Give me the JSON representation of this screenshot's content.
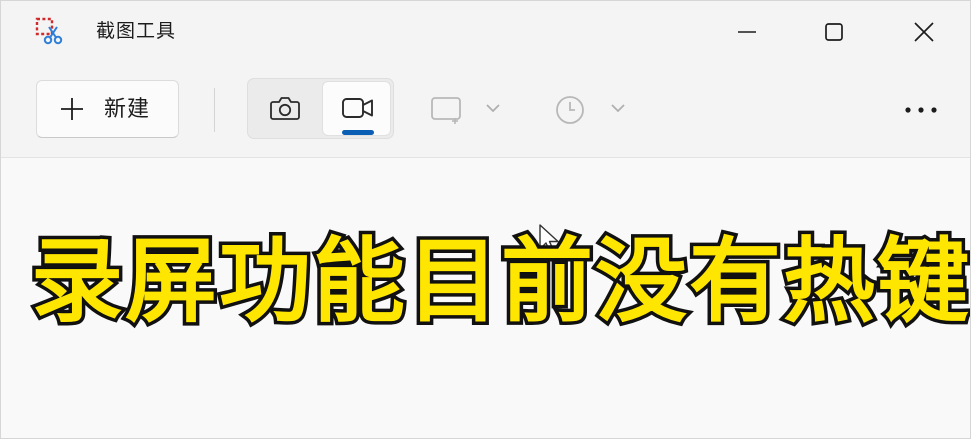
{
  "window": {
    "title": "截图工具",
    "app_icon": "snipping-tool-icon",
    "controls": {
      "minimize_icon": "minimize-icon",
      "maximize_icon": "maximize-icon",
      "close_icon": "close-icon"
    }
  },
  "toolbar": {
    "new_label": "新建",
    "new_icon": "plus-icon",
    "modes": [
      {
        "name": "screenshot",
        "icon": "camera-icon",
        "selected": false
      },
      {
        "name": "record",
        "icon": "video-camera-icon",
        "selected": true
      }
    ],
    "shape_dropdown_icon": "rectangle-snip-icon",
    "delay_dropdown_icon": "clock-icon",
    "more_icon": "more-horizontal-icon"
  },
  "content": {
    "caption": "录屏功能目前没有热键"
  },
  "colors": {
    "accent": "#0a5fb4",
    "caption_fill": "#ffe600",
    "caption_stroke": "#111111",
    "window_bg": "#f4f4f4",
    "content_bg": "#f9f9f9"
  }
}
